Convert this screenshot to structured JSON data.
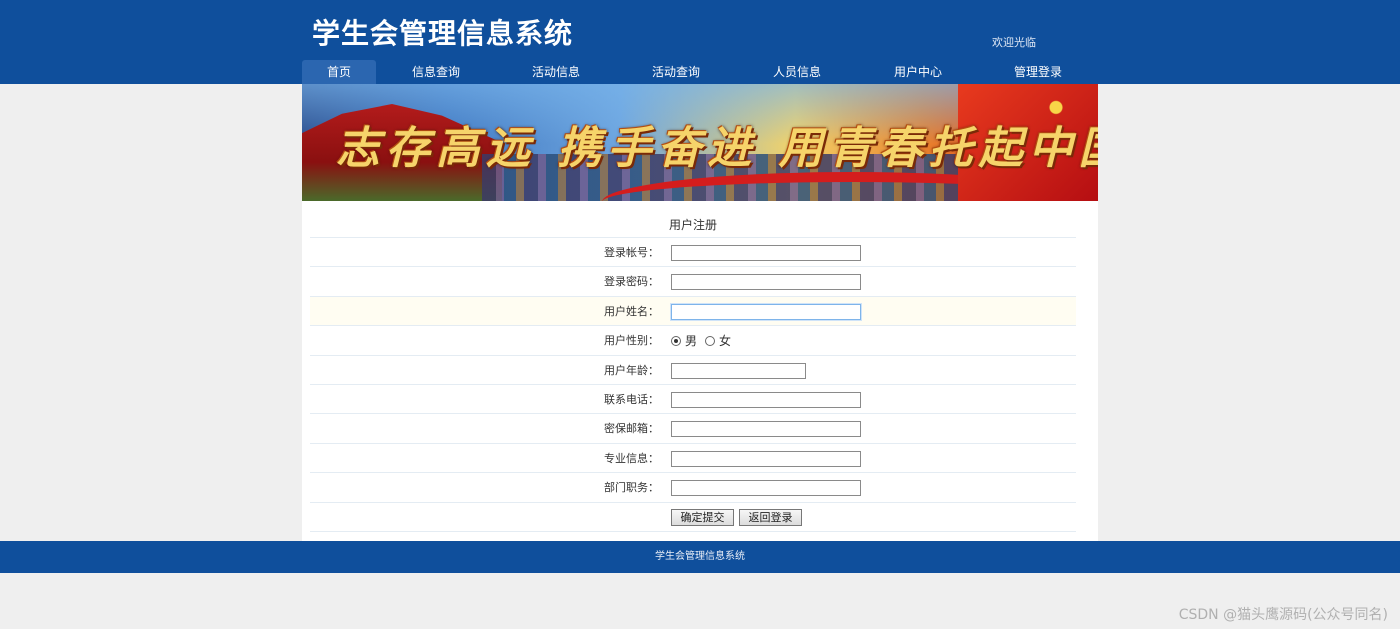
{
  "header": {
    "site_title": "学生会管理信息系统",
    "welcome": "欢迎光临"
  },
  "nav": {
    "items": [
      {
        "label": "首页",
        "active": true
      },
      {
        "label": "信息查询"
      },
      {
        "label": "活动信息"
      },
      {
        "label": "活动查询"
      },
      {
        "label": "人员信息"
      },
      {
        "label": "用户中心"
      },
      {
        "label": "管理登录"
      }
    ]
  },
  "banner": {
    "slogan": "志存高远 携手奋进 用青春托起中国梦"
  },
  "form": {
    "title": "用户注册",
    "fields": [
      {
        "label": "登录帐号：",
        "value": ""
      },
      {
        "label": "登录密码：",
        "value": ""
      },
      {
        "label": "用户姓名：",
        "value": ""
      },
      {
        "label": "用户性别：",
        "options": [
          "男",
          "女"
        ],
        "selected": "男"
      },
      {
        "label": "用户年龄：",
        "value": ""
      },
      {
        "label": "联系电话：",
        "value": ""
      },
      {
        "label": "密保邮箱：",
        "value": ""
      },
      {
        "label": "专业信息：",
        "value": ""
      },
      {
        "label": "部门职务：",
        "value": ""
      }
    ],
    "submit_label": "确定提交",
    "back_label": "返回登录"
  },
  "footer": {
    "text": "学生会管理信息系统"
  },
  "watermark": "CSDN @猫头鹰源码(公众号同名)"
}
